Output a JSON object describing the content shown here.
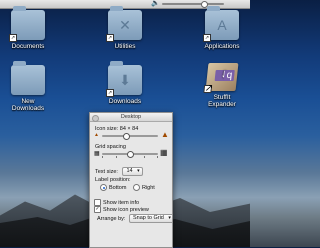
{
  "menubar": {
    "volume_icon": "speaker-icon",
    "volume_level": 0.68
  },
  "desktop_icons": [
    {
      "label": "Documents",
      "glyph": ""
    },
    {
      "label": "Utilities",
      "glyph": "✕"
    },
    {
      "label": "Applications",
      "glyph": "A"
    },
    {
      "label": "New\nDownloads",
      "glyph": ""
    },
    {
      "label": "Downloads",
      "glyph": "⬇"
    },
    {
      "label": "StuffIt\nExpander",
      "glyph": "q"
    }
  ],
  "panel": {
    "title": "Desktop",
    "icon_size_label": "Icon size:",
    "icon_size_value": "84 × 84",
    "icon_size_level": 0.42,
    "grid_spacing_label": "Grid spacing",
    "grid_spacing_level": 0.5,
    "text_size_label": "Text size:",
    "text_size_value": "14",
    "label_position_label": "Label position:",
    "label_bottom": "Bottom",
    "label_right": "Right",
    "show_item_info": "Show item info",
    "show_icon_preview": "Show icon preview",
    "arrange_by_label": "Arrange by:",
    "arrange_by_value": "Snap to Grid",
    "show_item_info_checked": false,
    "show_icon_preview_checked": true,
    "label_position_selected": "Bottom"
  }
}
